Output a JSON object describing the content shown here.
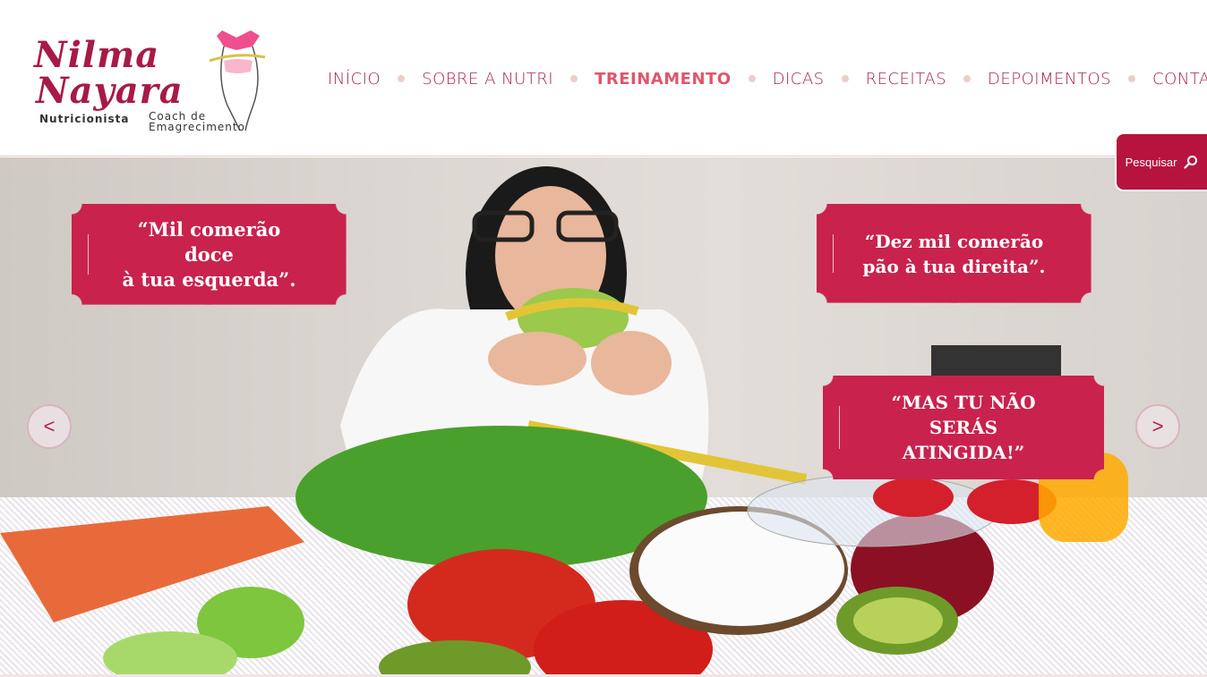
{
  "logo": {
    "name_line1": "Nilma",
    "name_line2": "Nayara",
    "subtitle_left": "Nutricionista",
    "subtitle_right_line1": "Coach de",
    "subtitle_right_line2": "Emagrecimento"
  },
  "nav": {
    "items": [
      {
        "label": "INÍCIO",
        "active": false
      },
      {
        "label": "SOBRE A NUTRI",
        "active": false
      },
      {
        "label": "TREINAMENTO",
        "active": true
      },
      {
        "label": "DICAS",
        "active": false
      },
      {
        "label": "RECEITAS",
        "active": false
      },
      {
        "label": "DEPOIMENTOS",
        "active": false
      },
      {
        "label": "CONTATO",
        "active": false
      }
    ]
  },
  "search": {
    "label": "Pesquisar",
    "icon": "search-icon"
  },
  "slider": {
    "quote1_line1": "“Mil comerão doce",
    "quote1_line2": "à tua esquerda”.",
    "quote2_line1": "“Dez mil comerão",
    "quote2_line2": "pão à tua direita”.",
    "quote3_line1": "“MAS TU NÃO",
    "quote3_line2": "SERÁS ATINGIDA!”",
    "prev_label": "<",
    "next_label": ">"
  },
  "colors": {
    "brand": "#a8234c",
    "nav_active": "#e0556b",
    "quote_bg": "#c9224d",
    "search_bg": "#b6143f"
  }
}
